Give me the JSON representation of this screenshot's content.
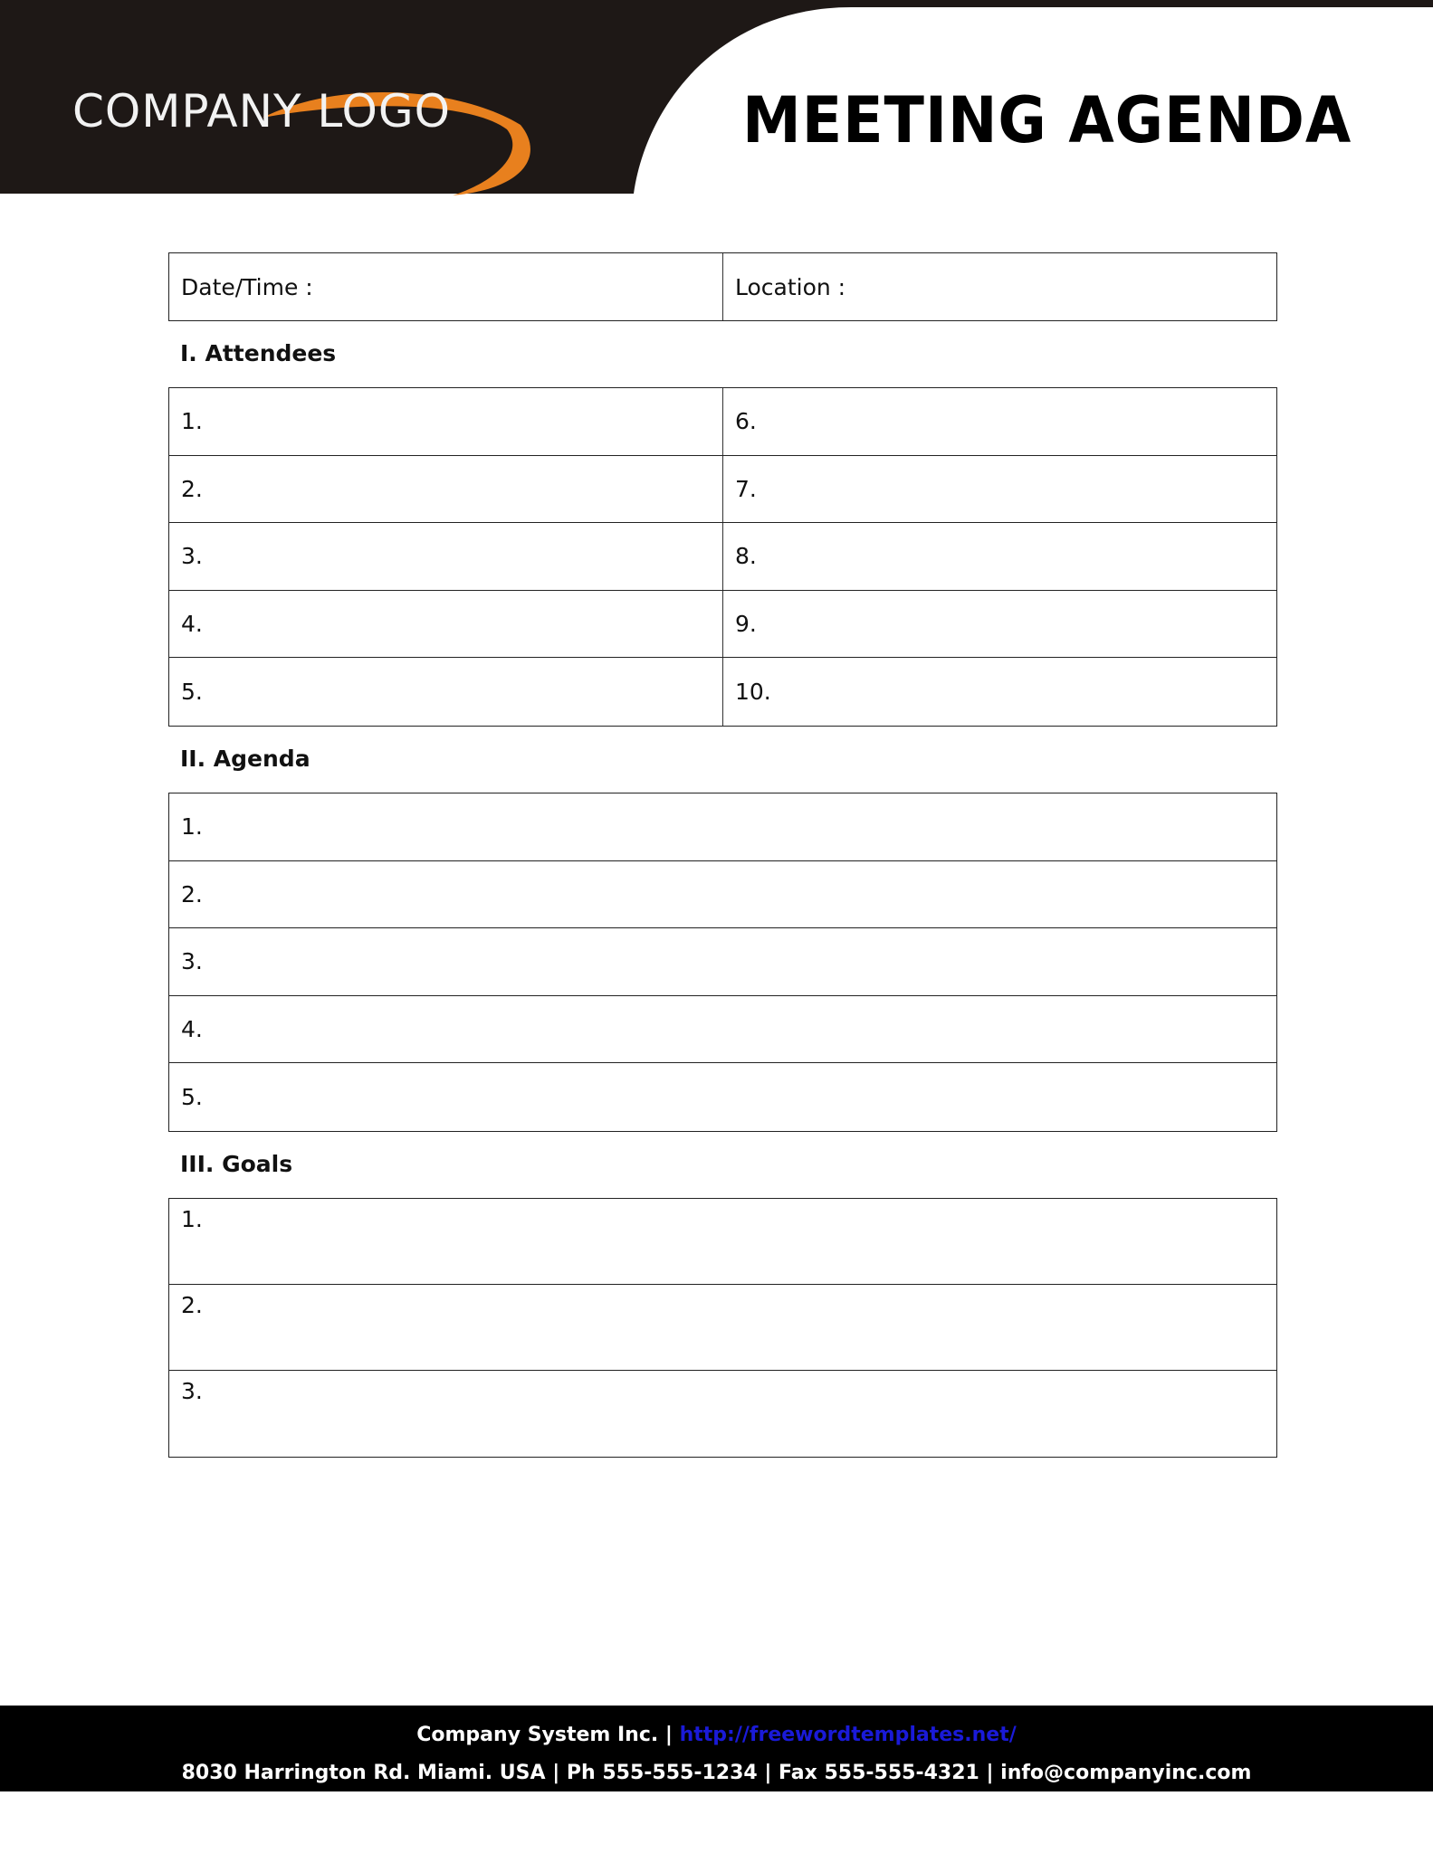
{
  "header": {
    "logo_text": "COMPANY LOGO",
    "title": "MEETING AGENDA",
    "colors": {
      "band": "#1e1816",
      "swoosh": "#e8801e"
    }
  },
  "info_row": {
    "date_time_label": "Date/Time :",
    "location_label": "Location :"
  },
  "attendees": {
    "heading": "I. Attendees",
    "rows": [
      [
        "1.",
        "6."
      ],
      [
        "2.",
        "7."
      ],
      [
        "3.",
        "8."
      ],
      [
        "4.",
        "9."
      ],
      [
        "5.",
        "10."
      ]
    ]
  },
  "agenda": {
    "heading": "II. Agenda",
    "rows": [
      "1.",
      "2.",
      "3.",
      "4.",
      "5."
    ]
  },
  "goals": {
    "heading": "III. Goals",
    "rows": [
      "1.",
      "2.",
      "3."
    ]
  },
  "footer": {
    "company": "Company System Inc. |",
    "url": "http://freewordtemplates.net/",
    "address_line": "8030 Harrington Rd. Miami. USA | Ph 555-555-1234 | Fax 555-555-4321 | info@companyinc.com",
    "link_color": "#1a1ad8"
  }
}
